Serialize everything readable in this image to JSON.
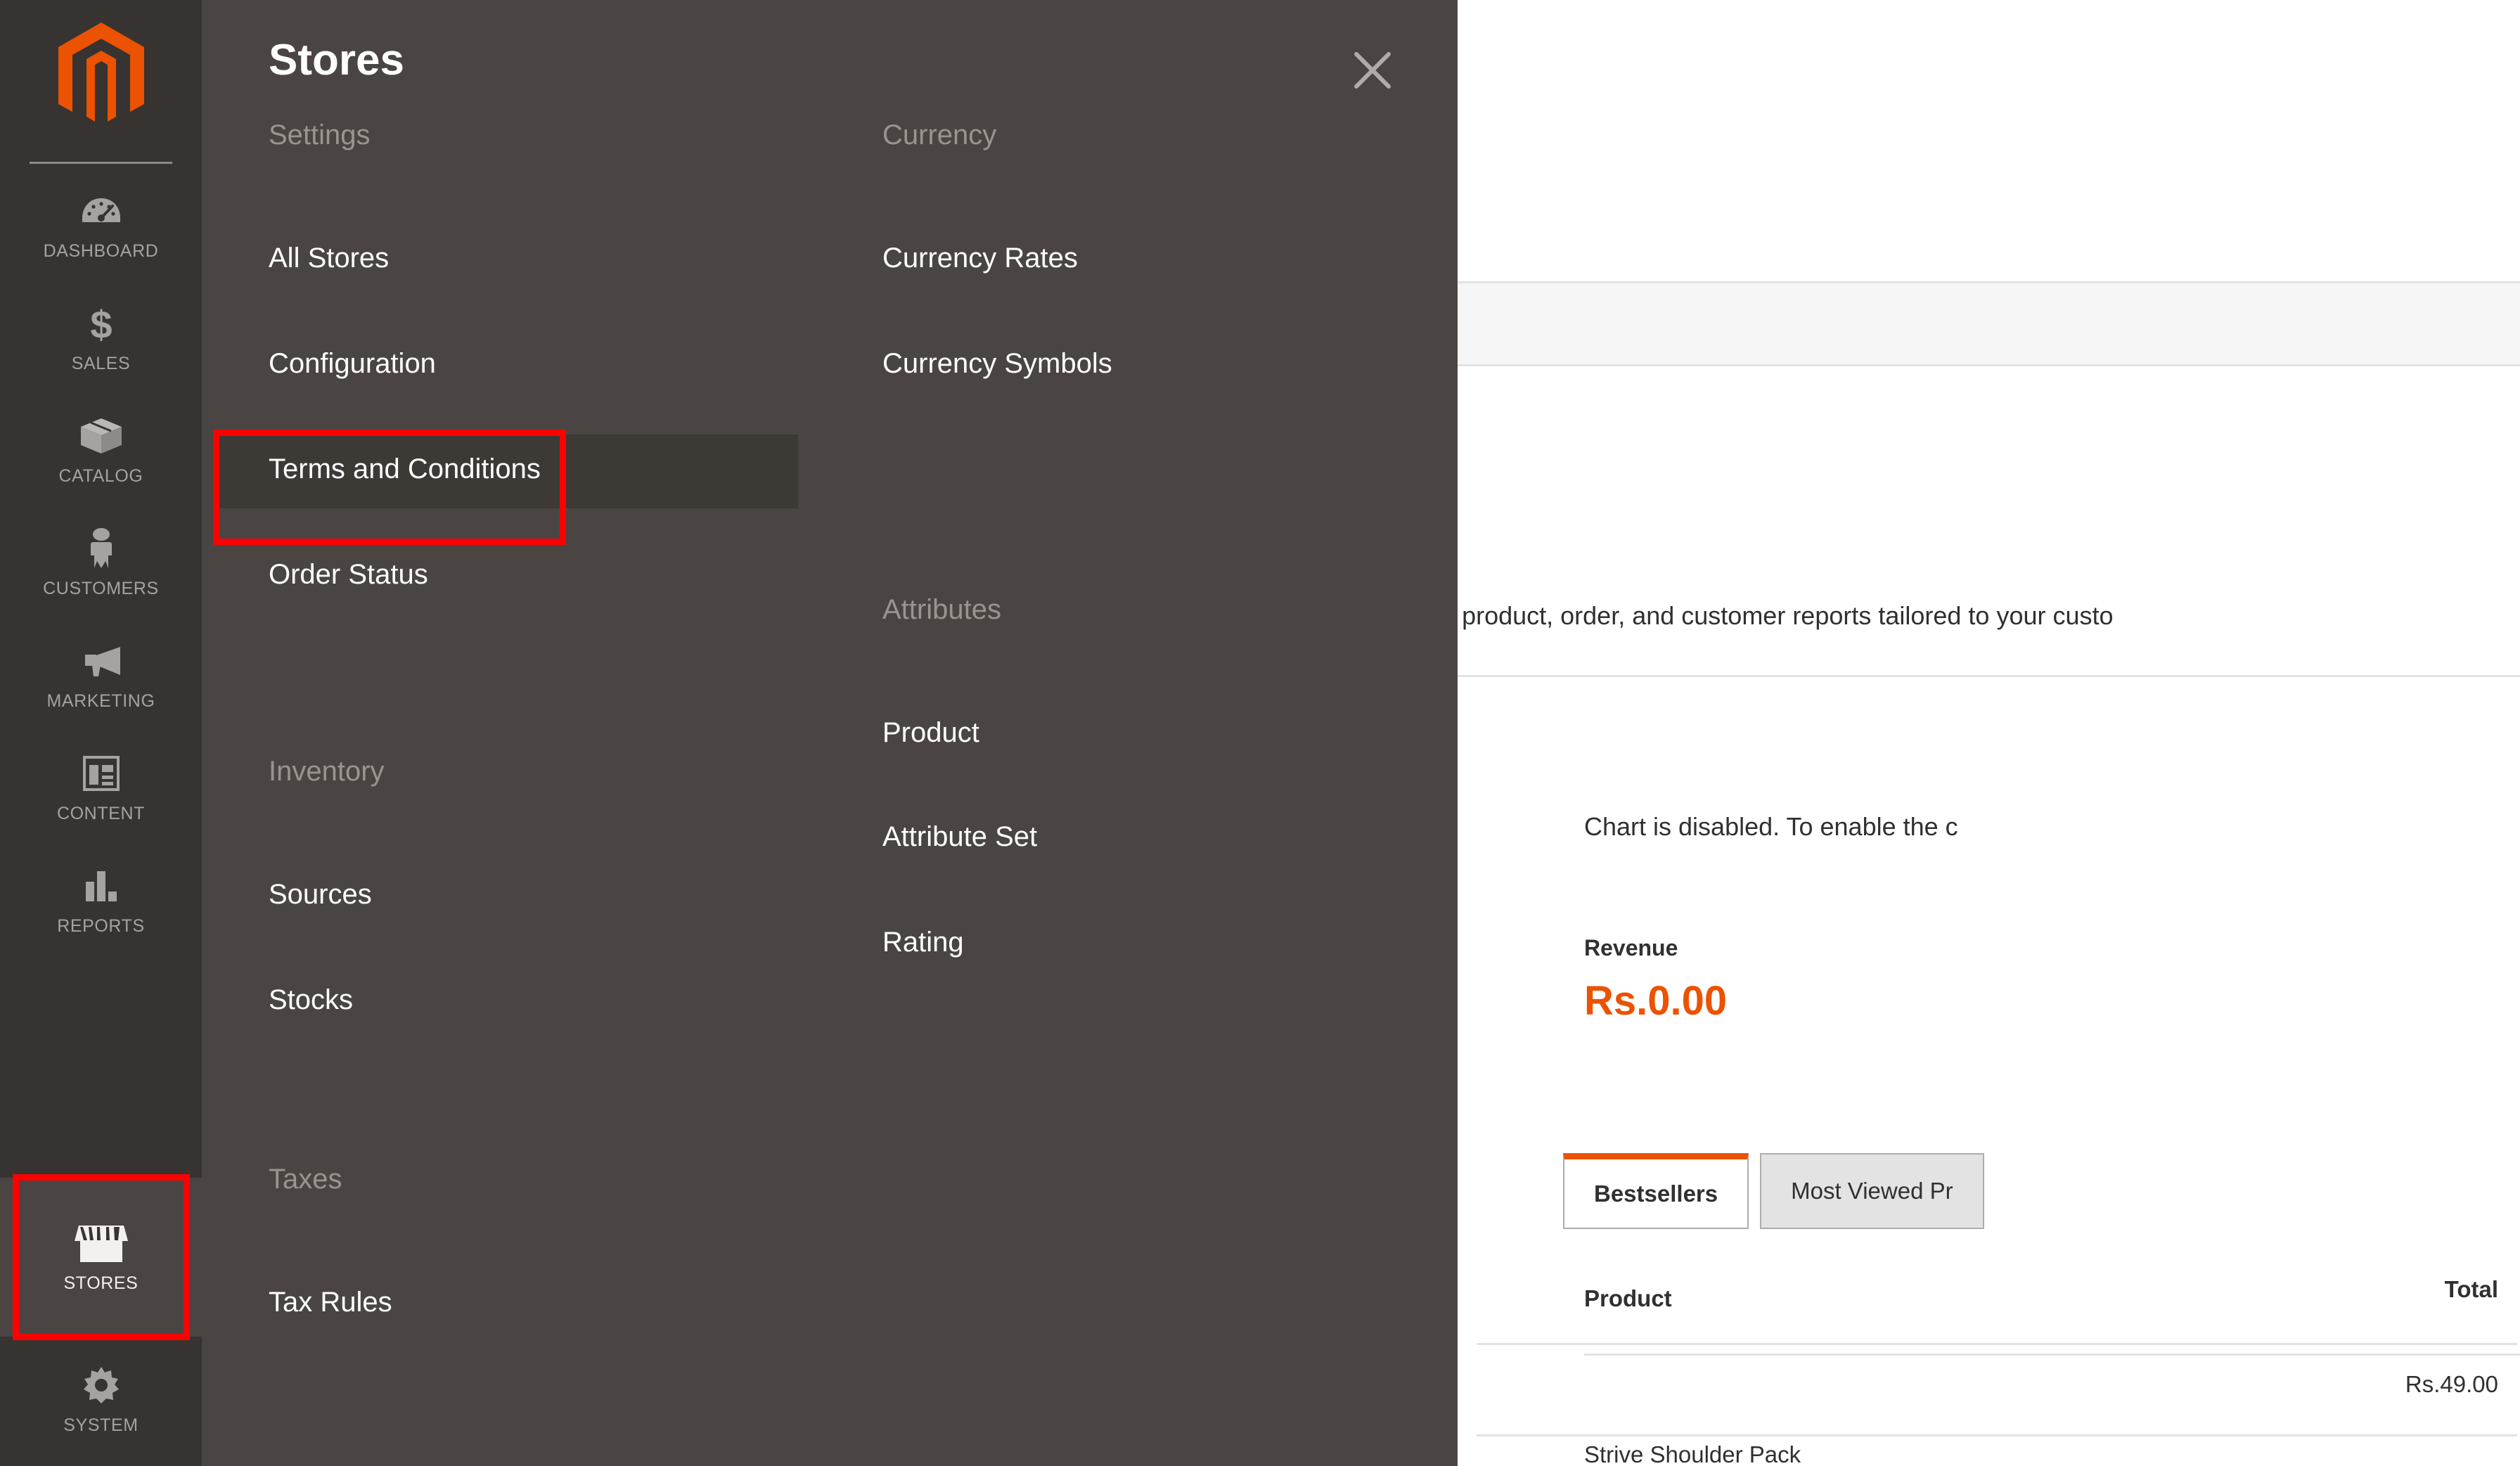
{
  "app": {
    "name": "Magento Admin",
    "logo_icon": "magento-logo-icon"
  },
  "sidebar": {
    "items": [
      {
        "label": "DASHBOARD",
        "icon": "dashboard-gauge-icon",
        "active": false
      },
      {
        "label": "SALES",
        "icon": "dollar-sign-icon",
        "active": false
      },
      {
        "label": "CATALOG",
        "icon": "box-package-icon",
        "active": false
      },
      {
        "label": "CUSTOMERS",
        "icon": "person-icon",
        "active": false
      },
      {
        "label": "MARKETING",
        "icon": "megaphone-icon",
        "active": false
      },
      {
        "label": "CONTENT",
        "icon": "layout-page-icon",
        "active": false
      },
      {
        "label": "REPORTS",
        "icon": "bar-chart-icon",
        "active": false
      },
      {
        "label": "STORES",
        "icon": "storefront-awning-icon",
        "active": true
      },
      {
        "label": "SYSTEM",
        "icon": "gear-icon",
        "active": false
      }
    ]
  },
  "menu_panel": {
    "title": "Stores",
    "close_icon": "close-x-icon",
    "columns": [
      {
        "groups": [
          {
            "title": "Settings",
            "items": [
              {
                "label": "All Stores",
                "highlighted": false
              },
              {
                "label": "Configuration",
                "highlighted": true
              },
              {
                "label": "Terms and Conditions",
                "highlighted": false
              },
              {
                "label": "Order Status",
                "highlighted": false
              }
            ]
          },
          {
            "title": "Inventory",
            "items": [
              {
                "label": "Sources",
                "highlighted": false
              },
              {
                "label": "Stocks",
                "highlighted": false
              }
            ]
          },
          {
            "title": "Taxes",
            "items": [
              {
                "label": "Tax Rules",
                "highlighted": false
              }
            ]
          }
        ]
      },
      {
        "groups": [
          {
            "title": "Currency",
            "items": [
              {
                "label": "Currency Rates",
                "highlighted": false
              },
              {
                "label": "Currency Symbols",
                "highlighted": false
              }
            ]
          },
          {
            "title": "Attributes",
            "items": [
              {
                "label": "Product",
                "highlighted": false
              },
              {
                "label": "Attribute Set",
                "highlighted": false
              },
              {
                "label": "Rating",
                "highlighted": false
              }
            ]
          }
        ]
      }
    ]
  },
  "content": {
    "description_text": "ur dynamic product, order, and customer reports tailored to your custo",
    "chart_disabled_text": "Chart is disabled. To enable the c",
    "revenue_label": "Revenue",
    "revenue_value": "Rs.0.00",
    "total_header": "Total",
    "total_value": "Rs.49.00",
    "tabs": [
      {
        "label": "Bestsellers",
        "active": true
      },
      {
        "label": "Most Viewed Pr",
        "active": false
      }
    ],
    "product_column_header": "Product",
    "product_rows": [
      {
        "name": "Strive Shoulder Pack"
      }
    ]
  },
  "colors": {
    "sidebar_bg": "#373330",
    "panel_bg": "#4a4542",
    "accent_orange": "#eb5202",
    "highlight_red": "#ff0000",
    "active_item_bg": "#3d3935"
  }
}
